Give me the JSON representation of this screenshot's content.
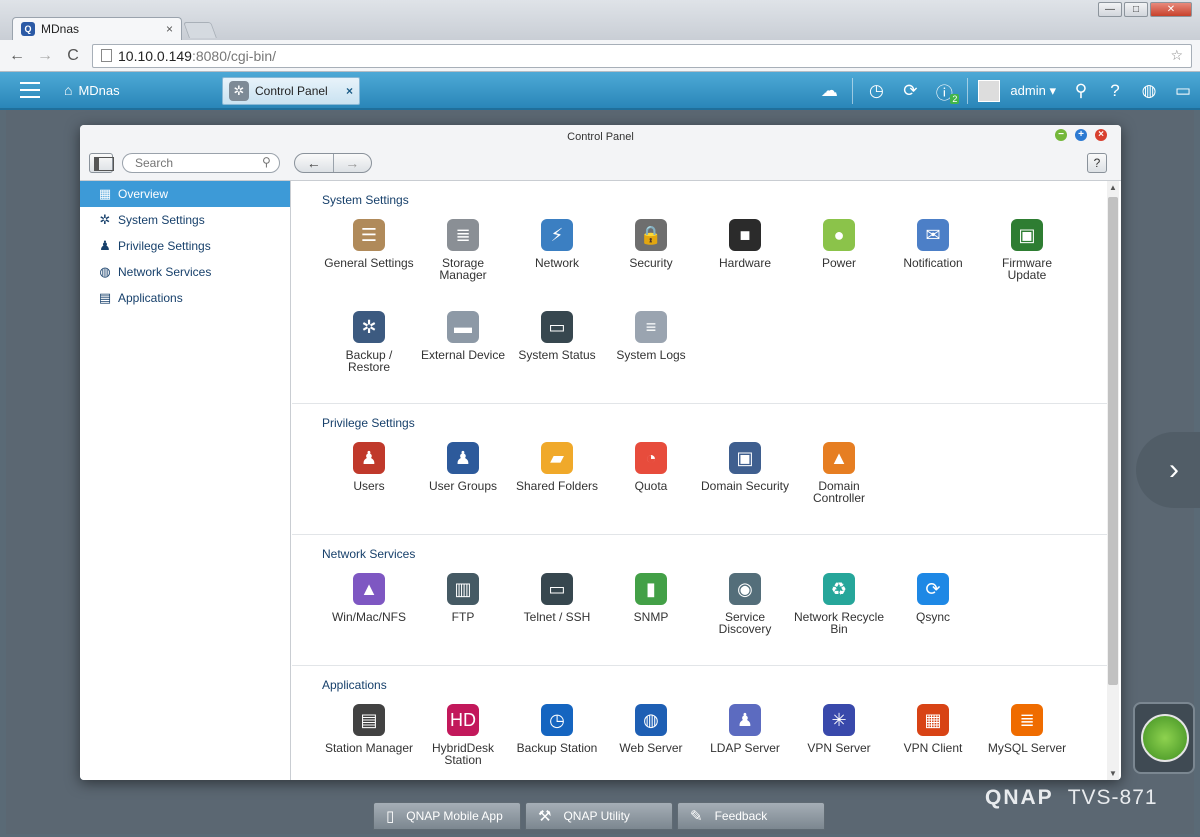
{
  "browser": {
    "tab_title": "MDnas",
    "tab_close": "×",
    "favicon": "Q",
    "url_host": "10.10.0.149",
    "url_path": ":8080/cgi-bin/",
    "back": "←",
    "forward": "→",
    "reload": "C",
    "star": "☆",
    "window_buttons": [
      "—",
      "□",
      "✕"
    ]
  },
  "header": {
    "home_label": "MDnas",
    "home_icon": "⌂",
    "app_tab_label": "Control Panel",
    "app_tab_close": "×",
    "app_tab_icon": "✲",
    "user": "admin",
    "user_caret": "▾",
    "info_badge": "2",
    "icons": {
      "cloud": "☁",
      "clock": "◷",
      "sync": "⟳",
      "info": "ⓘ",
      "search": "⚲",
      "help": "?",
      "globe": "◍",
      "monitor": "▭"
    },
    "accent": "#3a96c8"
  },
  "window": {
    "title": "Control Panel",
    "min": "−",
    "max": "+",
    "close": "×",
    "search_placeholder": "Search",
    "search_icon": "⚲",
    "back_arrow": "←",
    "forward_arrow": "→",
    "help": "?"
  },
  "sidebar": {
    "items": [
      {
        "label": "Overview",
        "icon": "▦"
      },
      {
        "label": "System Settings",
        "icon": "✲"
      },
      {
        "label": "Privilege Settings",
        "icon": "♟"
      },
      {
        "label": "Network Services",
        "icon": "◍"
      },
      {
        "label": "Applications",
        "icon": "▤"
      }
    ],
    "active_color": "#3d9ad7"
  },
  "sections": {
    "system": {
      "title": "System Settings",
      "items": [
        {
          "label": "General Settings",
          "icon": "☰",
          "color": "#b08a5a"
        },
        {
          "label": "Storage Manager",
          "icon": "≣",
          "color": "#8a8f95"
        },
        {
          "label": "Network",
          "icon": "⚡",
          "color": "#3b7fc2"
        },
        {
          "label": "Security",
          "icon": "🔒",
          "color": "#6e6e6e"
        },
        {
          "label": "Hardware",
          "icon": "■",
          "color": "#2b2b2b"
        },
        {
          "label": "Power",
          "icon": "●",
          "color": "#8bc34a"
        },
        {
          "label": "Notification",
          "icon": "✉",
          "color": "#4c7fc7"
        },
        {
          "label": "Firmware Update",
          "icon": "▣",
          "color": "#2e7d32"
        },
        {
          "label": "Backup / Restore",
          "icon": "✲",
          "color": "#3c5a80"
        },
        {
          "label": "External Device",
          "icon": "▬",
          "color": "#8d99a6"
        },
        {
          "label": "System Status",
          "icon": "▭",
          "color": "#37474f"
        },
        {
          "label": "System Logs",
          "icon": "≡",
          "color": "#9aa4b0"
        }
      ]
    },
    "privilege": {
      "title": "Privilege Settings",
      "items": [
        {
          "label": "Users",
          "icon": "♟",
          "color": "#c0392b"
        },
        {
          "label": "User Groups",
          "icon": "♟",
          "color": "#2d5a9b"
        },
        {
          "label": "Shared Folders",
          "icon": "▰",
          "color": "#f0a92a"
        },
        {
          "label": "Quota",
          "icon": "◔",
          "color": "#e74c3c"
        },
        {
          "label": "Domain Security",
          "icon": "▣",
          "color": "#3f5f8f"
        },
        {
          "label": "Domain Controller",
          "icon": "▲",
          "color": "#e67e22"
        }
      ]
    },
    "network": {
      "title": "Network Services",
      "items": [
        {
          "label": "Win/Mac/NFS",
          "icon": "▲",
          "color": "#7e57c2"
        },
        {
          "label": "FTP",
          "icon": "▥",
          "color": "#455a64"
        },
        {
          "label": "Telnet / SSH",
          "icon": "▭",
          "color": "#37474f"
        },
        {
          "label": "SNMP",
          "icon": "▮",
          "color": "#43a047"
        },
        {
          "label": "Service Discovery",
          "icon": "◉",
          "color": "#546e7a"
        },
        {
          "label": "Network Recycle Bin",
          "icon": "♻",
          "color": "#26a69a"
        },
        {
          "label": "Qsync",
          "icon": "⟳",
          "color": "#1e88e5"
        }
      ]
    },
    "applications": {
      "title": "Applications",
      "items": [
        {
          "label": "Station Manager",
          "icon": "▤",
          "color": "#424242"
        },
        {
          "label": "HybridDesk Station",
          "icon": "HD",
          "color": "#c2185b"
        },
        {
          "label": "Backup Station",
          "icon": "◷",
          "color": "#1565c0"
        },
        {
          "label": "Web Server",
          "icon": "◍",
          "color": "#1e5fb4"
        },
        {
          "label": "LDAP Server",
          "icon": "♟",
          "color": "#5c6bc0"
        },
        {
          "label": "VPN Server",
          "icon": "✳",
          "color": "#3949ab"
        },
        {
          "label": "VPN Client",
          "icon": "▦",
          "color": "#d84315"
        },
        {
          "label": "MySQL Server",
          "icon": "≣",
          "color": "#ef6c00"
        }
      ]
    }
  },
  "desktop": {
    "next_arrow": "›",
    "brand": "QNAP",
    "model": "TVS-871"
  },
  "dock": [
    {
      "label": "QNAP Mobile App",
      "icon": "▯"
    },
    {
      "label": "QNAP Utility",
      "icon": "⚒"
    },
    {
      "label": "Feedback",
      "icon": "✎"
    }
  ]
}
